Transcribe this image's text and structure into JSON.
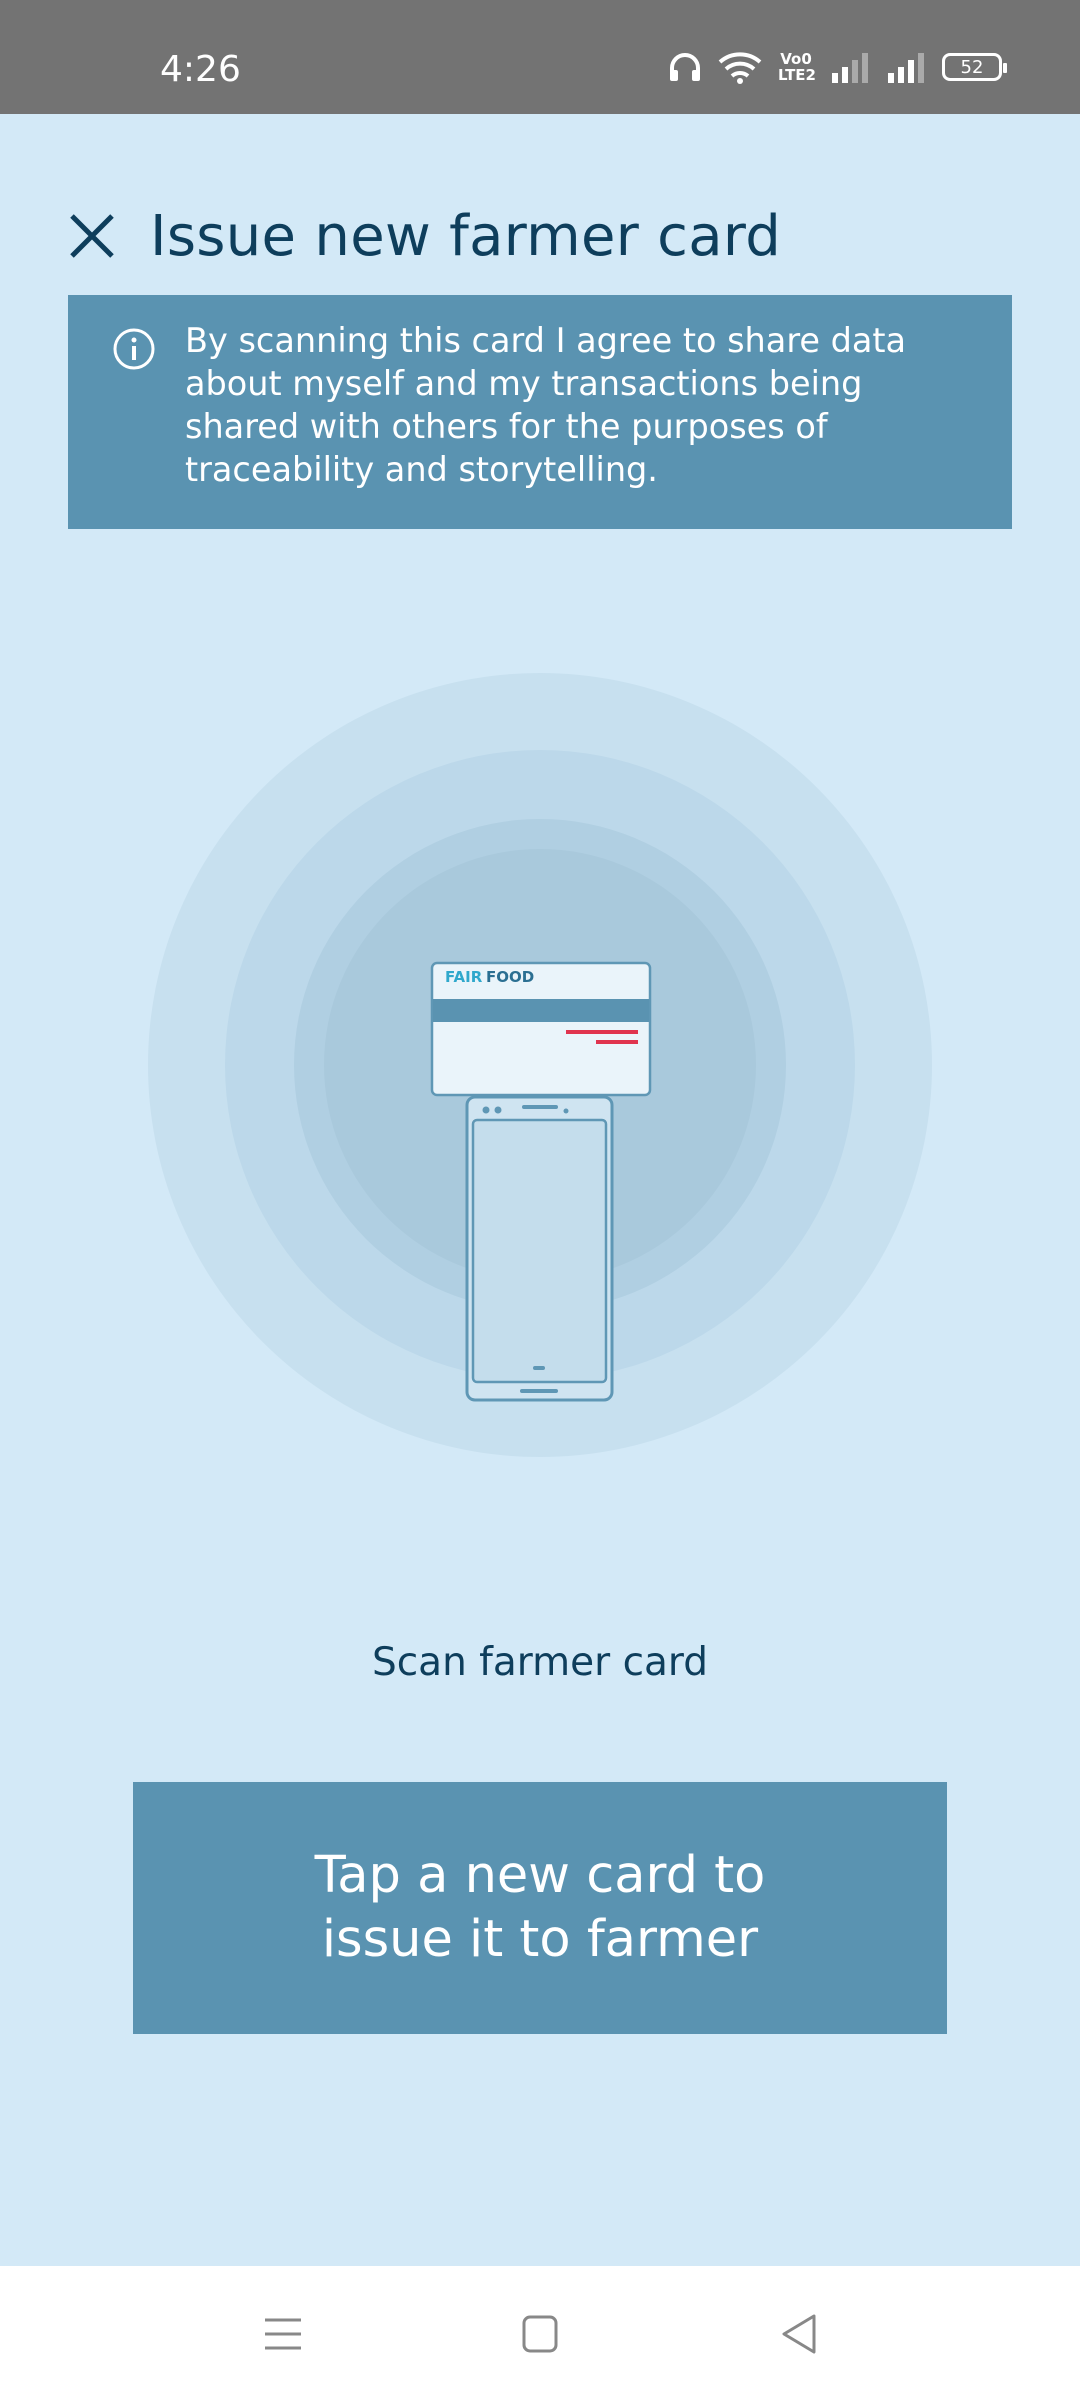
{
  "status_bar": {
    "time": "4:26",
    "network_label": "Vo0 LTE2",
    "battery_level": "52",
    "icons": [
      "headphones-icon",
      "wifi-icon",
      "volte-icon",
      "signal-icon",
      "signal-icon",
      "battery-icon"
    ]
  },
  "header": {
    "title": "Issue new farmer card",
    "close_icon": "close-icon"
  },
  "info_banner": {
    "icon": "info-icon",
    "text": "By scanning this card I agree to share data about myself and my transactions being shared with others for the purposes of traceability and storytelling."
  },
  "illustration": {
    "card_brand_left": "FAIR",
    "card_brand_right": "FOOD"
  },
  "scan_label": "Scan farmer card",
  "primary_button": {
    "label": "Tap a new card to issue it to farmer"
  },
  "nav_bar": {
    "icons": [
      "menu-icon",
      "home-icon",
      "back-icon"
    ]
  },
  "colors": {
    "background": "#d3e9f7",
    "accent": "#5a93b1",
    "title": "#0e3e5c",
    "status_bar": "#737373",
    "card_stripe": "#e0344e"
  }
}
